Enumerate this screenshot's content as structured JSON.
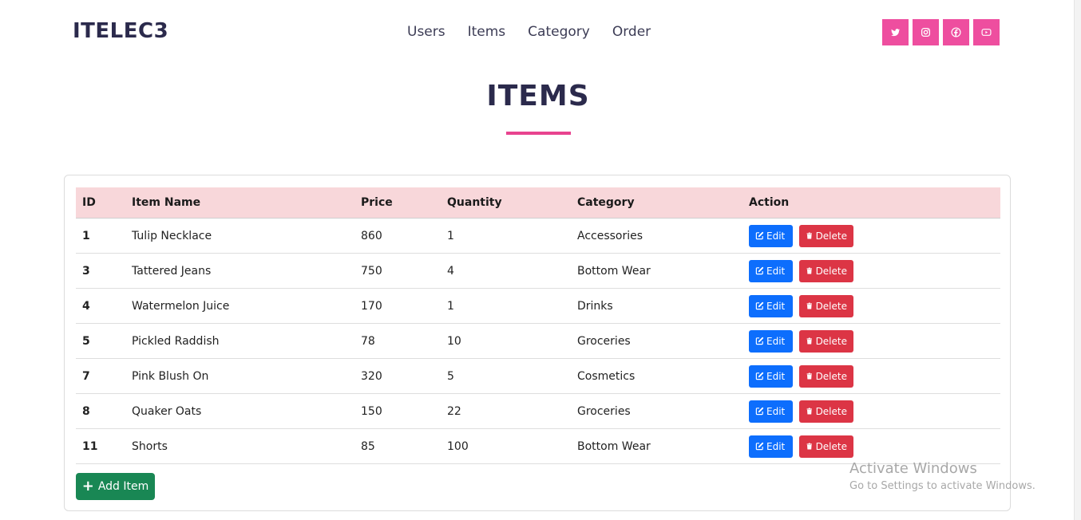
{
  "navbar": {
    "brand": "ITELEC3",
    "links": [
      "Users",
      "Items",
      "Category",
      "Order"
    ],
    "social_icons": [
      "twitter-icon",
      "instagram-icon",
      "facebook-icon",
      "youtube-icon"
    ],
    "accent_color": "#ee4e9f"
  },
  "page": {
    "title": "ITEMS"
  },
  "table": {
    "headers": [
      "ID",
      "Item Name",
      "Price",
      "Quantity",
      "Category",
      "Action"
    ],
    "rows": [
      {
        "id": "1",
        "name": "Tulip Necklace",
        "price": "860",
        "quantity": "1",
        "category": "Accessories"
      },
      {
        "id": "3",
        "name": "Tattered Jeans",
        "price": "750",
        "quantity": "4",
        "category": "Bottom Wear"
      },
      {
        "id": "4",
        "name": "Watermelon Juice",
        "price": "170",
        "quantity": "1",
        "category": "Drinks"
      },
      {
        "id": "5",
        "name": "Pickled Raddish",
        "price": "78",
        "quantity": "10",
        "category": "Groceries"
      },
      {
        "id": "7",
        "name": "Pink Blush On",
        "price": "320",
        "quantity": "5",
        "category": "Cosmetics"
      },
      {
        "id": "8",
        "name": "Quaker Oats",
        "price": "150",
        "quantity": "22",
        "category": "Groceries"
      },
      {
        "id": "11",
        "name": "Shorts",
        "price": "85",
        "quantity": "100",
        "category": "Bottom Wear"
      }
    ],
    "edit_label": "Edit",
    "delete_label": "Delete",
    "header_bg": "#f8d7da",
    "edit_color": "#0d6efd",
    "delete_color": "#dc3545"
  },
  "add_button": {
    "label": "Add Item",
    "color": "#198754"
  },
  "watermark": {
    "title": "Activate Windows",
    "subtitle": "Go to Settings to activate Windows."
  }
}
